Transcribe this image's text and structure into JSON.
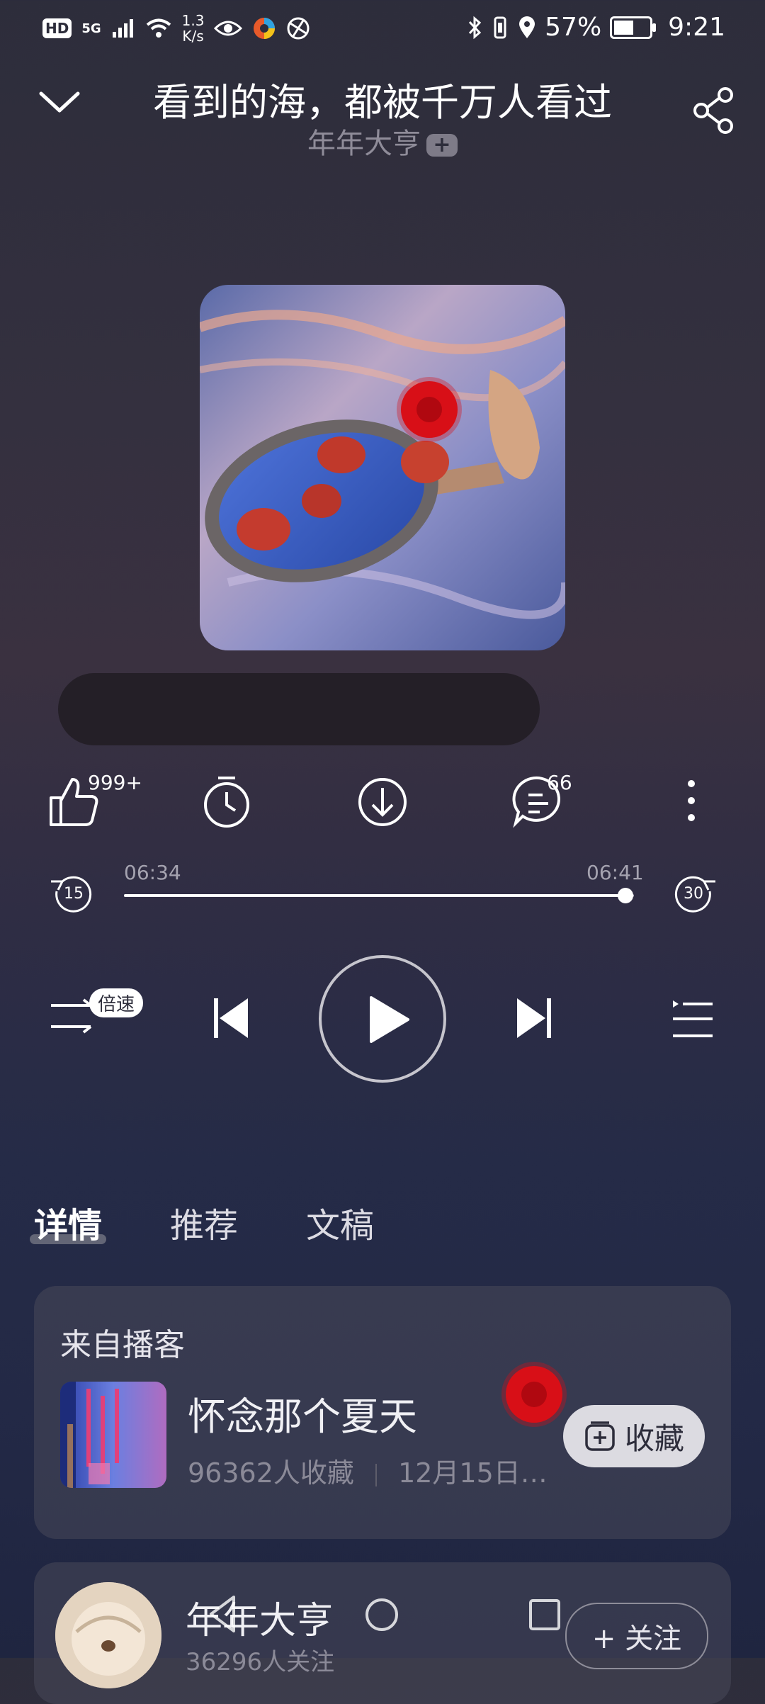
{
  "status_bar": {
    "hd": "HD",
    "net_type": "5G",
    "net_speed_value": "1.3",
    "net_speed_unit": "K/s",
    "battery_percent_text": "57%",
    "battery_level": 0.57,
    "time": "9:21"
  },
  "header": {
    "title": "看到的海，都被千万人看过",
    "author": "年年大亨",
    "author_badge": "+"
  },
  "actions": {
    "like_count": "999+",
    "comment_count": "66"
  },
  "player": {
    "current_time": "06:34",
    "total_time": "06:41",
    "progress": 0.983,
    "rewind_seconds": "15",
    "forward_seconds": "30",
    "speed_label": "倍速"
  },
  "tabs": [
    {
      "label": "详情",
      "active": true
    },
    {
      "label": "推荐",
      "active": false
    },
    {
      "label": "文稿",
      "active": false
    }
  ],
  "podcast": {
    "section_title": "来自播客",
    "name": "怀念那个夏天",
    "collect_count": "96362人收藏",
    "date": "12月15日…",
    "collect_label": "收藏"
  },
  "author_card": {
    "name": "年年大亨",
    "followers": "36296人关注",
    "follow_label": "+ 关注"
  },
  "colors": {
    "accent_red": "#d80f17",
    "background_top": "#2d2d3b",
    "background_bottom": "#1f2540"
  }
}
